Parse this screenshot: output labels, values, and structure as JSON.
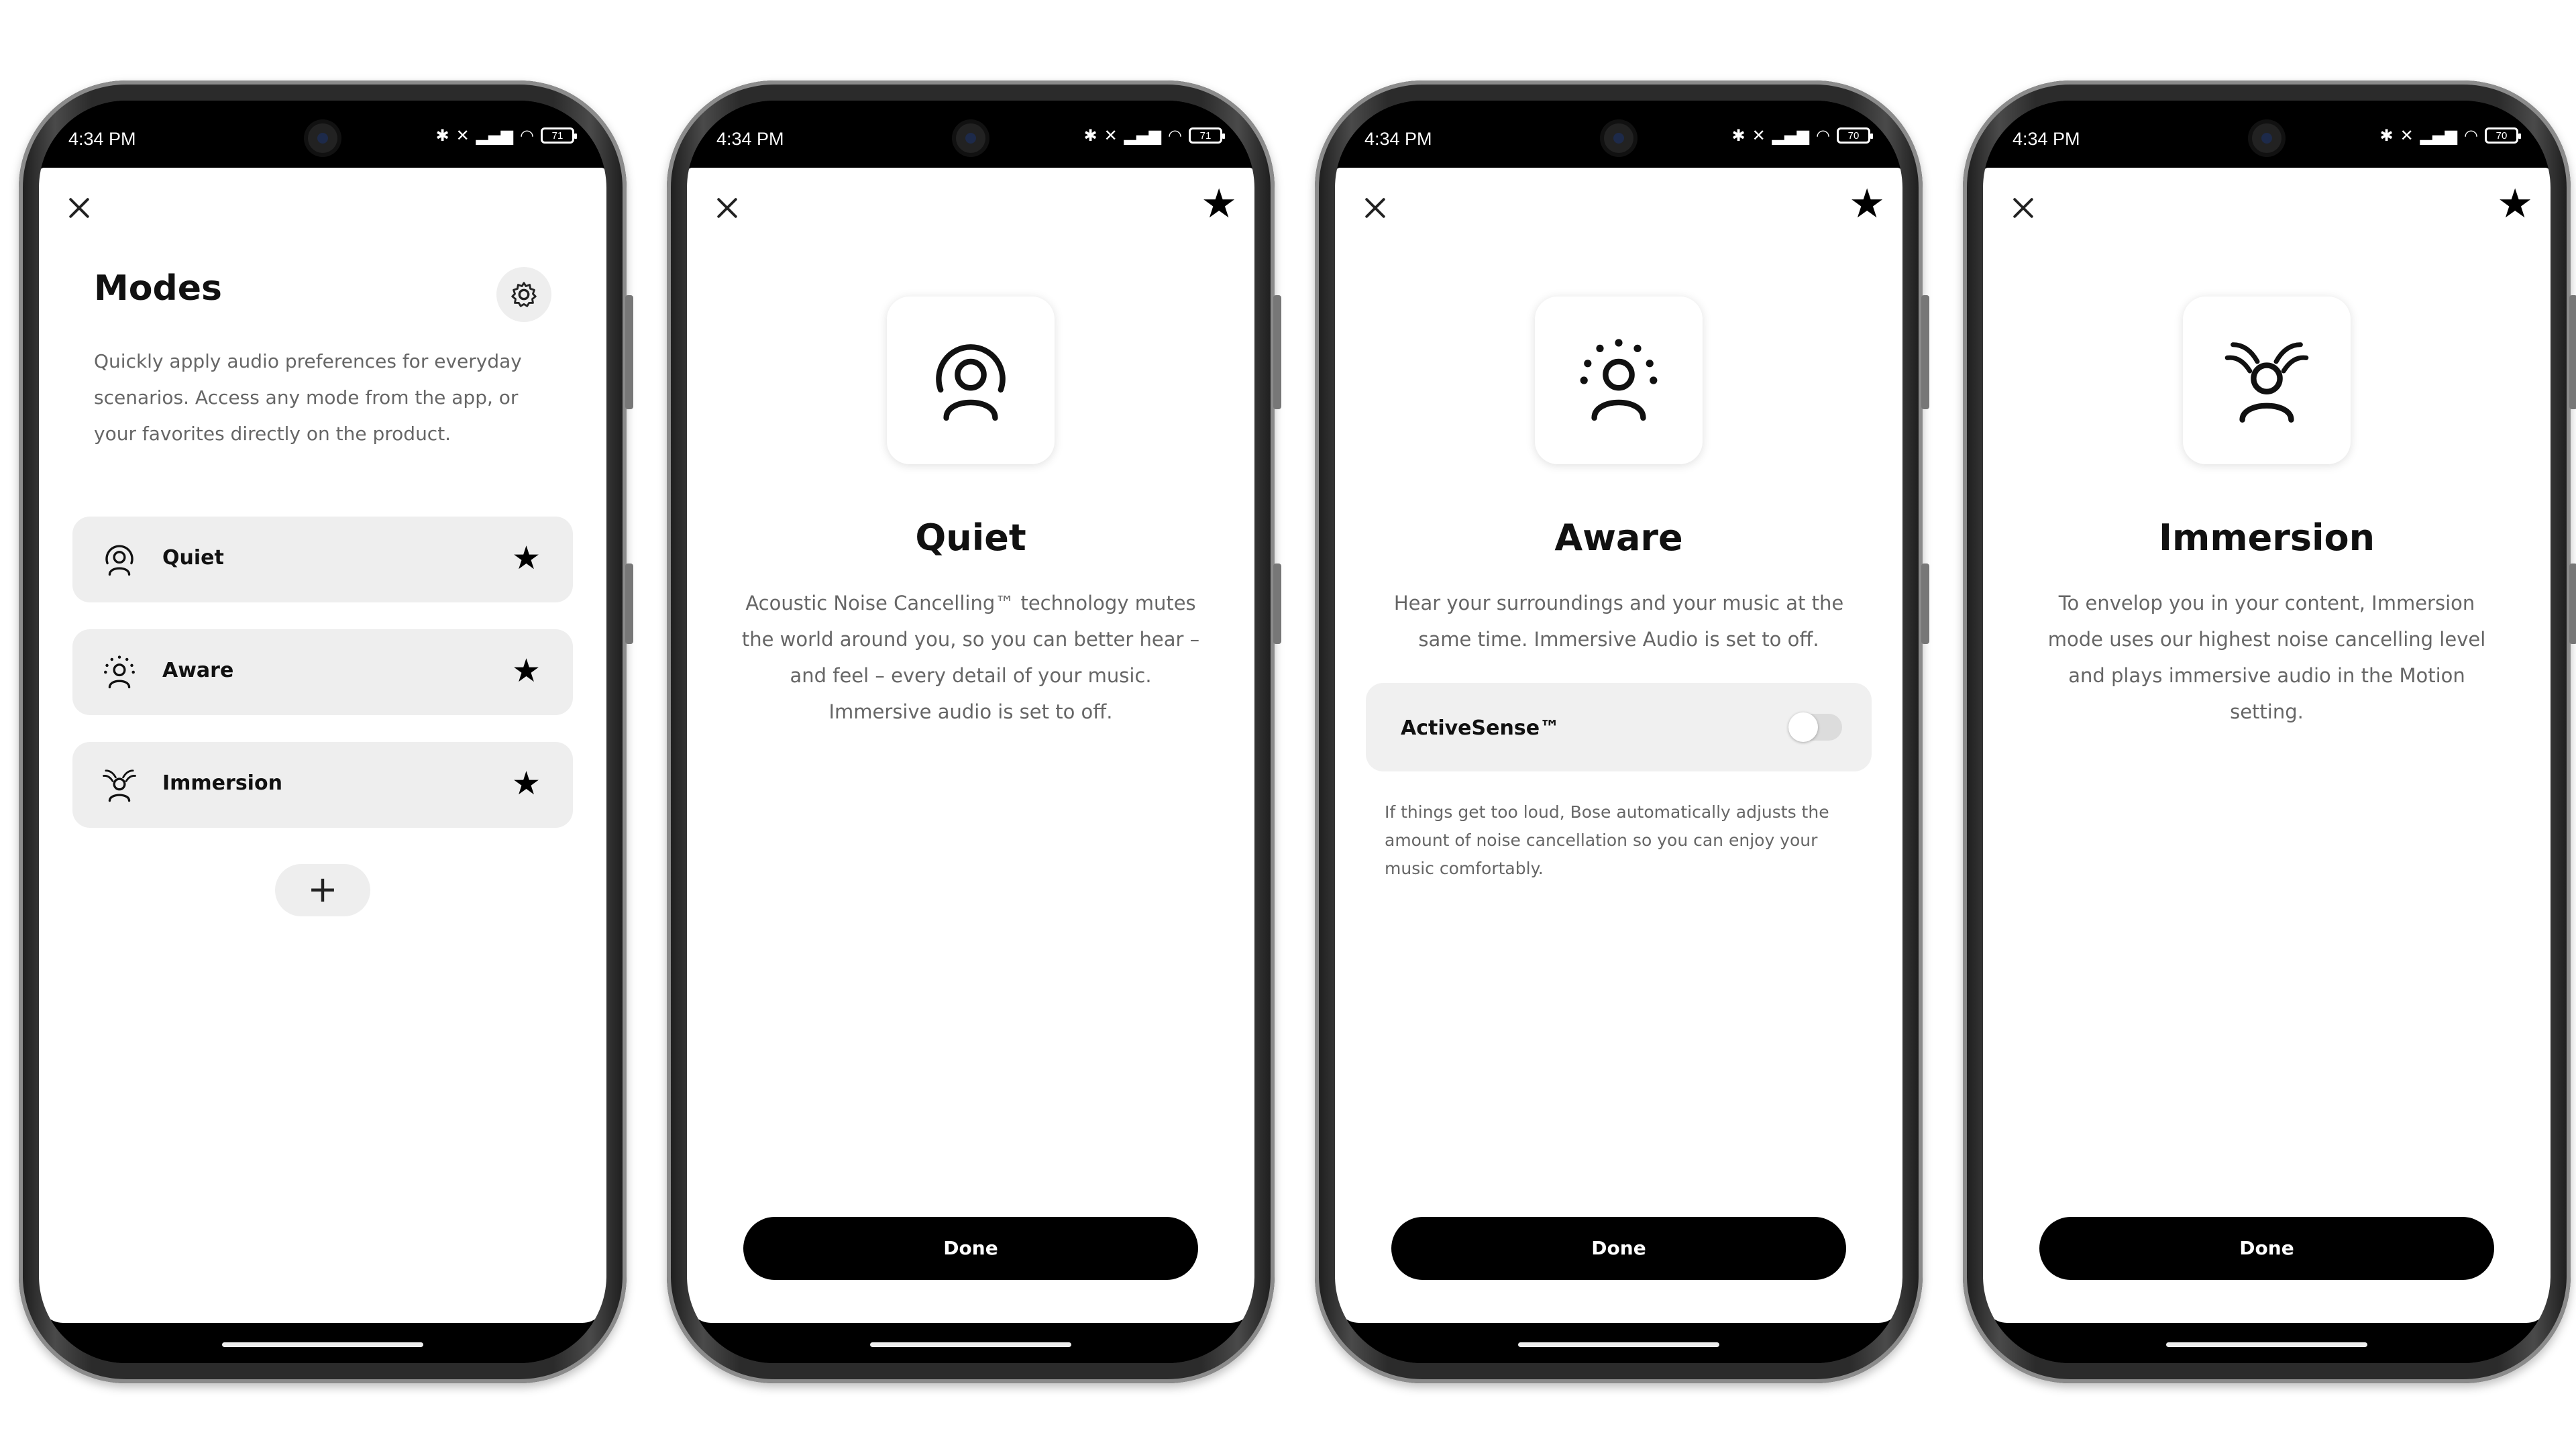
{
  "status": {
    "time": "4:34 PM",
    "battery": [
      "71",
      "71",
      "70",
      "70"
    ]
  },
  "icons": {
    "close": "close-icon",
    "star": "star-filled-icon",
    "gear": "gear-icon",
    "plus": "plus-icon"
  },
  "screen1": {
    "title": "Modes",
    "description": "Quickly apply audio preferences for everyday scenarios. Access any mode from the app, or your favorites directly on the product.",
    "modes": [
      {
        "label": "Quiet",
        "icon": "quiet-mode-icon"
      },
      {
        "label": "Aware",
        "icon": "aware-mode-icon"
      },
      {
        "label": "Immersion",
        "icon": "immersion-mode-icon"
      }
    ],
    "add_label": "+"
  },
  "screen2": {
    "name": "Quiet",
    "description": "Acoustic Noise Cancelling™ technology mutes the world around you, so you can better hear – and feel – every detail of your music. Immersive audio is set to off.",
    "done": "Done"
  },
  "screen3": {
    "name": "Aware",
    "description": "Hear your surroundings and your music at the same time. Immersive Audio is set to off.",
    "activesense_label": "ActiveSense™",
    "activesense_on": false,
    "activesense_note": "If things get too loud, Bose automatically adjusts the amount of noise cancellation so you can enjoy your music comfortably.",
    "done": "Done"
  },
  "screen4": {
    "name": "Immersion",
    "description": "To envelop you in your content, Immersion mode uses our highest noise cancelling level and plays immersive audio in the Motion setting.",
    "done": "Done"
  }
}
